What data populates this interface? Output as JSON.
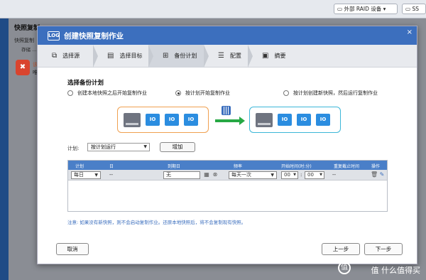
{
  "background": {
    "external_raid_label": "外部 RAID 设备",
    "corner_label": "SS",
    "panel_title": "快照复制",
    "panel_subtitle": "快照复制",
    "panel_tab": "存储 ...",
    "warning_line1": "该",
    "warning_line2": "唯"
  },
  "dialog": {
    "logo_text": "LOG",
    "title": "创建快照复制作业",
    "close_glyph": "×"
  },
  "steps": [
    {
      "label": "选择源",
      "icon": "cube-icon"
    },
    {
      "label": "选择目标",
      "icon": "database-icon"
    },
    {
      "label": "备份计划",
      "icon": "schedule-icon"
    },
    {
      "label": "配置",
      "icon": "list-icon"
    },
    {
      "label": "摘要",
      "icon": "clipboard-icon"
    }
  ],
  "schedule": {
    "section_title": "选择备份计划",
    "options": [
      {
        "label": "创建本地快照之后开始复制作业",
        "selected": false
      },
      {
        "label": "按计划开始复制作业",
        "selected": true
      },
      {
        "label": "按计划创建新快照，然后运行复制作业",
        "selected": false
      }
    ],
    "disk_label": "IO",
    "plan_label": "计划:",
    "plan_value": "按计划运行",
    "add_button": "增加"
  },
  "table": {
    "headers": [
      "计划",
      "日",
      "到期日",
      "频率",
      "开始时间(时:分)",
      "重复截止时间",
      "操作"
    ],
    "row": {
      "plan": "每日",
      "day": "--",
      "expire": "无",
      "frequency": "每天一次",
      "hour": "00",
      "colon": ":",
      "minute": "00",
      "repeat_end": "--"
    }
  },
  "note": "注意: 如果没有新快照，则不会启动复制作业。还原本地快照后，将不会复制现有快照。",
  "buttons": {
    "cancel": "取消",
    "prev": "上一步",
    "next": "下一步"
  },
  "watermark": "值 什么值得买",
  "colors": {
    "accent": "#3c6fbe",
    "source_border": "#f0a050",
    "target_border": "#3cb7d8",
    "arrow": "#27a844"
  }
}
